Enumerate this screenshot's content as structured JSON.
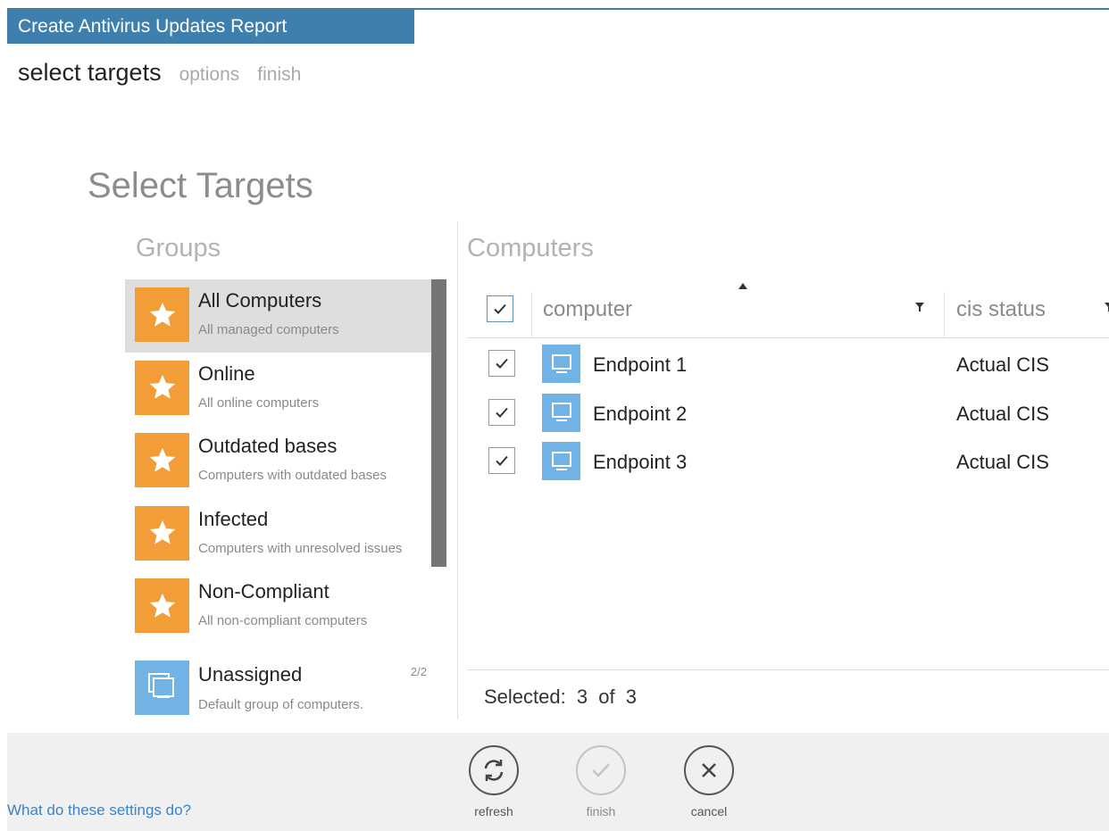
{
  "window": {
    "title": "Create Antivirus Updates Report"
  },
  "steps": {
    "current": "select targets",
    "options": "options",
    "finish": "finish"
  },
  "page": {
    "title": "Select Targets"
  },
  "groups": {
    "heading": "Groups",
    "items": [
      {
        "name": "All Computers",
        "desc": "All managed computers",
        "icon": "star-icon",
        "selected": true
      },
      {
        "name": "Online",
        "desc": "All online computers",
        "icon": "star-icon"
      },
      {
        "name": "Outdated bases",
        "desc": "Computers with outdated bases",
        "icon": "star-icon"
      },
      {
        "name": "Infected",
        "desc": "Computers with unresolved issues",
        "icon": "star-icon"
      },
      {
        "name": "Non-Compliant",
        "desc": "All non-compliant computers",
        "icon": "star-icon"
      },
      {
        "name": "Unassigned",
        "desc": "Default group of computers.",
        "icon": "group-icon",
        "count": "2/2"
      }
    ]
  },
  "computers": {
    "heading": "Computers",
    "columns": {
      "computer": "computer",
      "cis_status": "cis status"
    },
    "rows": [
      {
        "name": "Endpoint 1",
        "cis": "Actual CIS",
        "checked": true
      },
      {
        "name": "Endpoint 2",
        "cis": "Actual CIS",
        "checked": true
      },
      {
        "name": "Endpoint 3",
        "cis": "Actual CIS",
        "checked": true
      }
    ],
    "selected_label": "Selected:",
    "selected_count": "3",
    "of_label": "of",
    "total_count": "3"
  },
  "footer": {
    "help_link": "What do these settings do?",
    "refresh_label": "refresh",
    "finish_label": "finish",
    "cancel_label": "cancel"
  },
  "colors": {
    "title_bar": "#3f7fae",
    "group_orange": "#f29d38",
    "computer_blue": "#71b3e4",
    "link": "#3c84c7"
  }
}
